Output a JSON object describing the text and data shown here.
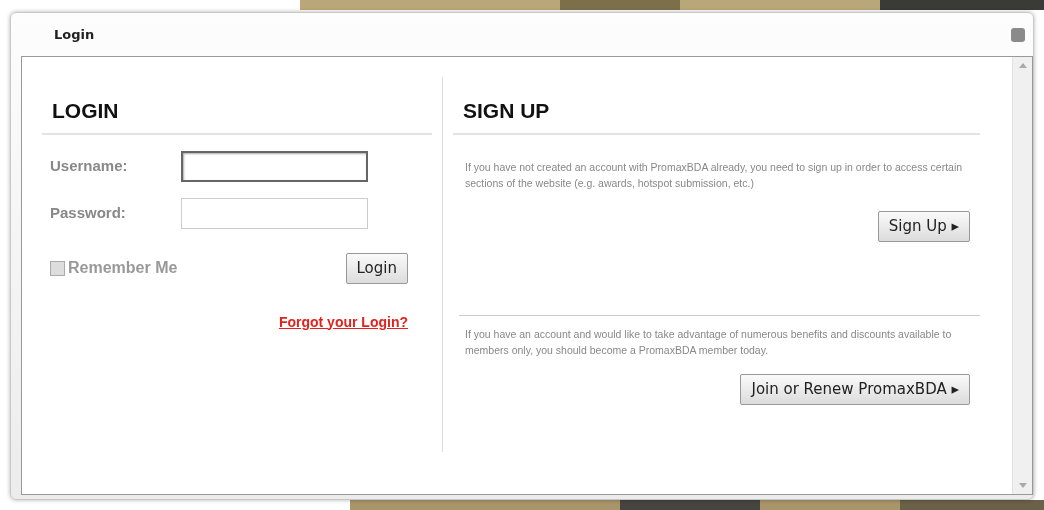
{
  "dialog": {
    "title": "Login"
  },
  "login": {
    "heading": "LOGIN",
    "fields": [
      {
        "label": "Username:",
        "focused": true
      },
      {
        "label": "Password:",
        "focused": false
      }
    ],
    "remember": {
      "label": "Remember Me",
      "checked": false
    },
    "button": "Login",
    "forgot_link": "Forgot your Login?"
  },
  "signup": {
    "heading": "SIGN UP",
    "sections": [
      {
        "text": "If you have not created an account with PromaxBDA already, you need to sign up in order to access certain sections of the website (e.g. awards, hotspot submission, etc.)",
        "button": "Sign Up ▸"
      },
      {
        "text": "If you have an account and would like to take advantage of numerous benefits and discounts available to members only, you should become a PromaxBDA member today.",
        "button": "Join or Renew PromaxBDA ▸"
      }
    ]
  }
}
